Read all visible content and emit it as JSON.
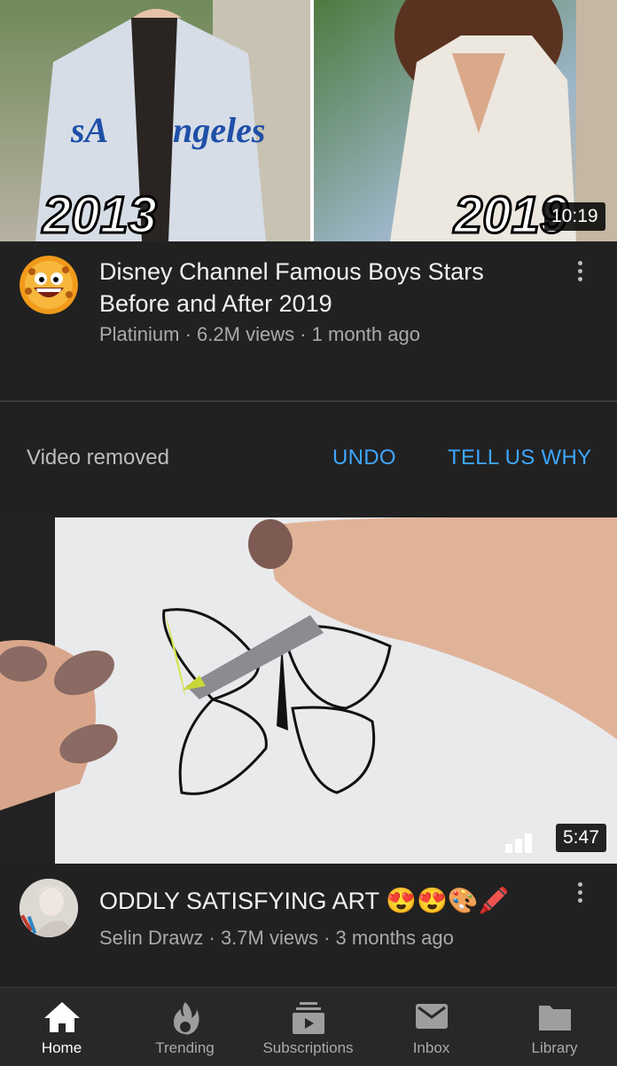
{
  "video1": {
    "thumbnail_text_left": "2013",
    "thumbnail_text_right": "2019",
    "duration": "10:19",
    "title": "Disney Channel Famous Boys Stars Before and After 2019",
    "channel": "Platinium",
    "views": "6.2M views",
    "age": "1 month ago",
    "separator": " · "
  },
  "removed": {
    "message": "Video removed",
    "undo": "UNDO",
    "tell_us_why": "TELL US WHY"
  },
  "video2": {
    "duration": "5:47",
    "title": "ODDLY SATISFYING ART",
    "title_emojis": "😍😍🎨🖍️",
    "channel": "Selin Drawz",
    "views": "3.7M views",
    "age": "3 months ago"
  },
  "nav": {
    "items": [
      {
        "label": "Home",
        "icon": "home-icon"
      },
      {
        "label": "Trending",
        "icon": "flame-icon"
      },
      {
        "label": "Subscriptions",
        "icon": "subscriptions-icon"
      },
      {
        "label": "Inbox",
        "icon": "mail-icon"
      },
      {
        "label": "Library",
        "icon": "folder-icon"
      }
    ],
    "active": "Home"
  },
  "colors": {
    "background": "#212121",
    "accent": "#3ea6ff",
    "secondary_text": "#aaaaaa"
  }
}
